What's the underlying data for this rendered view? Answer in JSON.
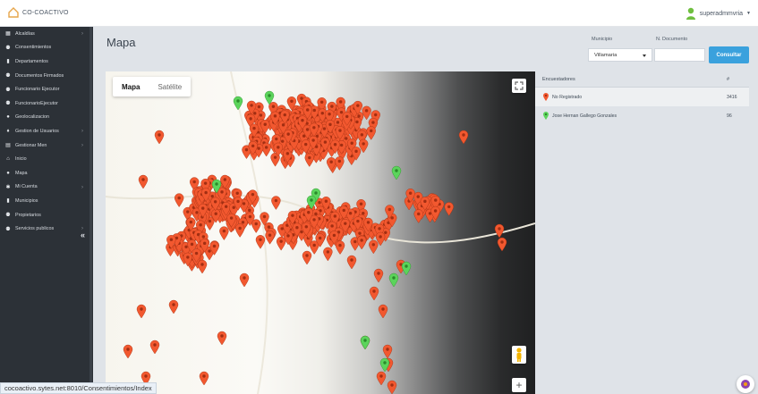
{
  "app": {
    "logo_text": "CO-COACTIVO",
    "user_name": "superadmmvria"
  },
  "sidebar": {
    "items": [
      {
        "label": "Alcaldías",
        "icon": "table-icon",
        "has_arrow": true
      },
      {
        "label": "Consentimientos",
        "icon": "users-icon",
        "has_arrow": false
      },
      {
        "label": "Departamentos",
        "icon": "building-icon",
        "has_arrow": false
      },
      {
        "label": "Documentos Firmados",
        "icon": "users-icon",
        "has_arrow": false
      },
      {
        "label": "Funcionario Ejecutor",
        "icon": "users-icon",
        "has_arrow": false
      },
      {
        "label": "FuncionarioEjecutor",
        "icon": "users-icon",
        "has_arrow": false
      },
      {
        "label": "Geolocalizacion",
        "icon": "map-marker-icon",
        "has_arrow": false
      },
      {
        "label": "Gestion de Usuarios",
        "icon": "user-tie-icon",
        "has_arrow": true
      },
      {
        "label": "Gestionar Men",
        "icon": "grid-icon",
        "has_arrow": true
      },
      {
        "label": "Inicio",
        "icon": "home-icon",
        "has_arrow": false
      },
      {
        "label": "Mapa",
        "icon": "map-marker-icon",
        "has_arrow": false
      },
      {
        "label": "Mi Cuenta",
        "icon": "gear-icon",
        "has_arrow": true
      },
      {
        "label": "Municipios",
        "icon": "building-icon",
        "has_arrow": false
      },
      {
        "label": "Propietarios",
        "icon": "users-icon",
        "has_arrow": false
      },
      {
        "label": "Servicios publicos",
        "icon": "users-icon",
        "has_arrow": true
      }
    ],
    "collapse_label": "«"
  },
  "header": {
    "title": "Mapa",
    "municipio_label": "Municipio",
    "documento_label": "N. Documento",
    "municipio_value": "Villamaria",
    "documento_value": "",
    "consultar_label": "Consultar"
  },
  "map": {
    "tabs": [
      "Mapa",
      "Satélite"
    ],
    "active_tab": "Mapa",
    "zoom_in_label": "+"
  },
  "encuestadores": {
    "header_name": "Encuestadores",
    "header_count": "#",
    "rows": [
      {
        "name": "No Registrado",
        "count": "3416",
        "color": "#f2582f"
      },
      {
        "name": "Jose Hernan Gallego Gonzales",
        "count": "96",
        "color": "#5bd45b"
      }
    ]
  },
  "status_bar": {
    "url": "cocoactivo.sytes.net:8010/Consentimientos/Index"
  },
  "colors": {
    "marker_orange": "#f2582f",
    "marker_green": "#5bd45b",
    "accent": "#3aa1dd",
    "sidebar_bg": "#2c3137"
  }
}
